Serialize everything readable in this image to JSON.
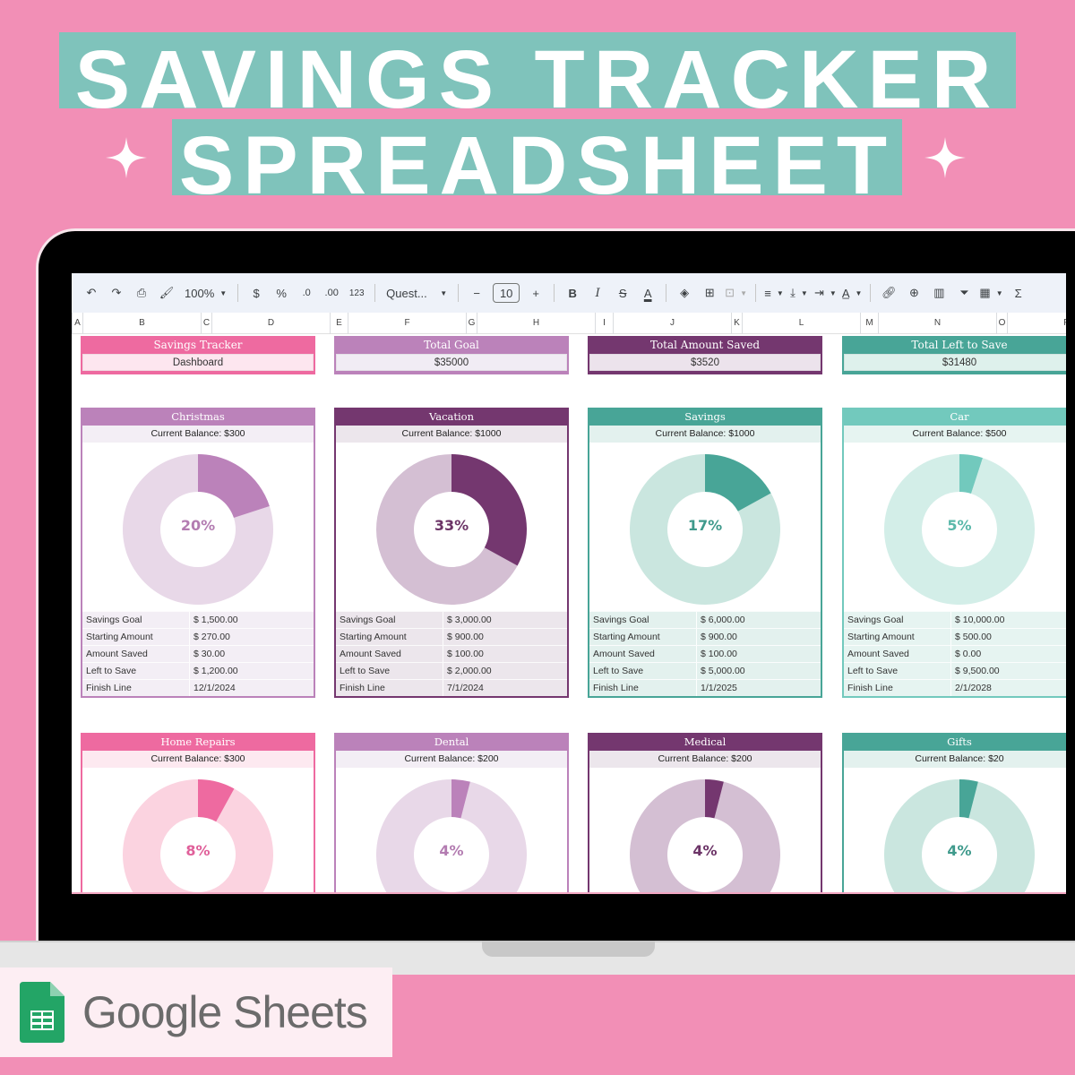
{
  "banner": {
    "line1": "SAVINGS TRACKER",
    "line2": "SPREADSHEET",
    "bg_color": "#f28fb6",
    "highlight_color": "#7fc3bb"
  },
  "toolbar": {
    "undo_icon": "undo-icon",
    "redo_icon": "redo-icon",
    "print_icon": "print-icon",
    "paint_format_icon": "paint-format-icon",
    "zoom": "100%",
    "currency": "$",
    "percent": "%",
    "decrease_decimal": ".0",
    "increase_decimal": ".00",
    "number_format": "123",
    "font": "Quest...",
    "font_size_minus": "−",
    "font_size": "10",
    "font_size_plus": "+",
    "bold": "B",
    "italic": "I",
    "strikethrough": "S",
    "text_color": "A",
    "sum": "Σ"
  },
  "columns": [
    "A",
    "B",
    "C",
    "D",
    "E",
    "F",
    "G",
    "H",
    "I",
    "J",
    "K",
    "L",
    "M",
    "N",
    "O",
    "P"
  ],
  "summary": [
    {
      "title": "Savings Tracker",
      "value": "Dashboard",
      "header_color": "#ee6aa0",
      "body_color": "#fde6ef",
      "border_color": "#ee6aa0"
    },
    {
      "title": "Total Goal",
      "value": "$35000",
      "header_color": "#bb82ba",
      "body_color": "#f1ecf4",
      "border_color": "#bb82ba"
    },
    {
      "title": "Total Amount Saved",
      "value": "$3520",
      "header_color": "#74376f",
      "body_color": "#ece3ec",
      "border_color": "#74376f"
    },
    {
      "title": "Total Left to Save",
      "value": "$31480",
      "header_color": "#48a597",
      "body_color": "#def1ec",
      "border_color": "#48a597"
    }
  ],
  "row_labels": [
    "Savings Goal",
    "Starting Amount",
    "Amount Saved",
    "Left to Save",
    "Finish Line"
  ],
  "cards": [
    {
      "title": "Christmas",
      "balance": "Current Balance: $300",
      "percent": 0.2,
      "percent_label": "20%",
      "header_color": "#bb82ba",
      "balance_bg": "#f3eef5",
      "accent": "#bb82ba",
      "track": "#e8d8e8",
      "text_color": "#b37cb1",
      "row_bg": "#f3eef5",
      "rows": [
        "$  1,500.00",
        "$  270.00",
        "$  30.00",
        "$  1,200.00",
        "12/1/2024"
      ]
    },
    {
      "title": "Vacation",
      "balance": "Current Balance: $1000",
      "percent": 0.33,
      "percent_label": "33%",
      "header_color": "#74376f",
      "balance_bg": "#ece6ec",
      "accent": "#74376f",
      "track": "#d4bfd3",
      "text_color": "#6c3467",
      "row_bg": "#ece6ec",
      "rows": [
        "$  3,000.00",
        "$  900.00",
        "$  100.00",
        "$  2,000.00",
        "7/1/2024"
      ]
    },
    {
      "title": "Savings",
      "balance": "Current Balance: $1000",
      "percent": 0.17,
      "percent_label": "17%",
      "header_color": "#48a597",
      "balance_bg": "#e3f1ee",
      "accent": "#48a597",
      "track": "#cae6df",
      "text_color": "#3f9a8c",
      "row_bg": "#e3f1ee",
      "rows": [
        "$  6,000.00",
        "$  900.00",
        "$  100.00",
        "$  5,000.00",
        "1/1/2025"
      ]
    },
    {
      "title": "Car",
      "balance": "Current Balance: $500",
      "percent": 0.05,
      "percent_label": "5%",
      "header_color": "#72c9bd",
      "balance_bg": "#e6f4f1",
      "accent": "#72c9bd",
      "track": "#d3eee8",
      "text_color": "#5ab8aa",
      "row_bg": "#e6f4f1",
      "rows": [
        "$  10,000.00",
        "$  500.00",
        "$  0.00",
        "$  9,500.00",
        "2/1/2028"
      ]
    },
    {
      "title": "Home Repairs",
      "balance": "Current Balance: $300",
      "percent": 0.08,
      "percent_label": "8%",
      "header_color": "#ee6aa0",
      "balance_bg": "#fde9f0",
      "accent": "#ee6aa0",
      "track": "#fbd3e0",
      "text_color": "#e0609a"
    },
    {
      "title": "Dental",
      "balance": "Current Balance: $200",
      "percent": 0.04,
      "percent_label": "4%",
      "header_color": "#bb82ba",
      "balance_bg": "#f3eef5",
      "accent": "#bb82ba",
      "track": "#e8d8e8",
      "text_color": "#b37cb1"
    },
    {
      "title": "Medical",
      "balance": "Current Balance: $200",
      "percent": 0.04,
      "percent_label": "4%",
      "header_color": "#74376f",
      "balance_bg": "#ece6ec",
      "accent": "#74376f",
      "track": "#d4bfd3",
      "text_color": "#6c3467"
    },
    {
      "title": "Gifts",
      "balance": "Current Balance: $20",
      "percent": 0.04,
      "percent_label": "4%",
      "header_color": "#48a597",
      "balance_bg": "#e3f1ee",
      "accent": "#48a597",
      "track": "#cae6df",
      "text_color": "#3f9a8c"
    }
  ],
  "badge": {
    "name": "Google Sheets",
    "icon": "google-sheets-icon"
  }
}
